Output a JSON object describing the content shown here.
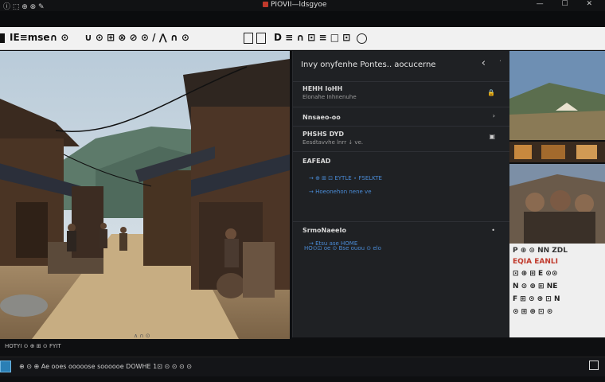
{
  "window": {
    "title_left": "ⓘ ⬚ ⊕ ⊗ ✎",
    "title_center": "PIOVII—ldsgyoe",
    "controls": "— ☐ ✕"
  },
  "toolbar": {
    "items": [
      "IE≡mse∩ ⊙",
      "∪ ⊙ ⊞ ⊗ ⊘ ⊙ / ⋀ ∩ ⊙",
      "D ≡ ∩ ⊡ ≡ □ ⊡"
    ]
  },
  "image": {
    "caption": "∧ ∩ ⊙"
  },
  "panel": {
    "title": "Invy onyfenhe Pontes.. aocucerne",
    "sections": [
      {
        "heading": "HEHH  IoHH",
        "sub": "Elonahe Inhnenuhe",
        "icon": "🔒"
      },
      {
        "heading": "Nnsaeo-oo",
        "sub": "",
        "icon": "›"
      },
      {
        "heading": "PHSHS DYD",
        "sub": "Eesdtavvhe lnrr ↓ ve.",
        "icon": "▣"
      },
      {
        "heading": "EAFEAD",
        "sub": "",
        "icon": ""
      },
      {
        "heading": "",
        "blue1": "→ ⊕ ⊞ ⊡ EYTLE ⋆ FSELKTE",
        "blue2": "→ Hoeonehon nene ve",
        "icon": ""
      },
      {
        "heading": "SrmoNaeeIo",
        "sub": "",
        "icon": "•"
      },
      {
        "heading": "",
        "blue1": "→ Etsu ase HOME",
        "blue2": "HO⊙⊡ oe ⊙ Bse ouou ⊙ elo",
        "icon": ""
      }
    ]
  },
  "side_text": {
    "lines": [
      "P ⊕ ⊙ NN ZDL",
      "EQIA EANLI",
      "⊡ ⊕ ⊞ E ⊙⊙",
      "N ⊙ ⊕ ⊞ NE",
      "F ⊞ ⊙ ⊕ ⊡ N",
      "⊙ ⊞ ⊕ ⊡ ⊙"
    ]
  },
  "status": {
    "text": "HOTYI ⊙ ⊕ ⊞ ⊙ FYIT"
  },
  "bottom": {
    "text": "⊕ ⊙ ⊕ Ae ooes ooooose soooooe DOWHE 1⊡ ⊙ ⊙ ⊙ ⊙"
  }
}
